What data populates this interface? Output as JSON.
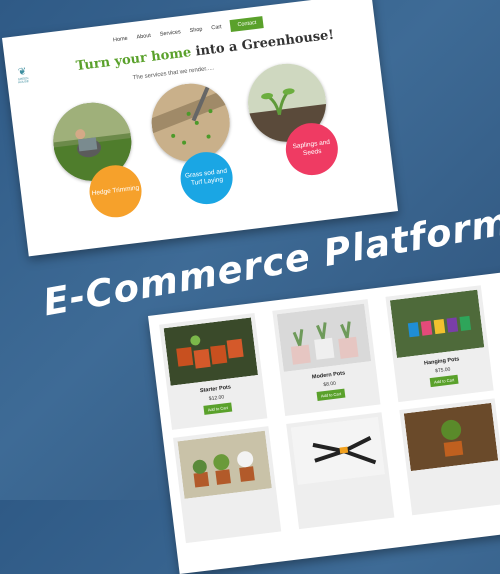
{
  "nav": {
    "items": [
      "Home",
      "About",
      "Services",
      "Shop",
      "Cart"
    ],
    "contact_label": "Contact"
  },
  "logo": {
    "text": "GREEN HOUSE"
  },
  "hero": {
    "headline_green": "Turn your home",
    "headline_rest": " into a Greenhouse!",
    "subtitle": "The services that we render....."
  },
  "services": [
    {
      "label": "Hedge Trimming",
      "color": "#f6a12b"
    },
    {
      "label": "Grass sod and Turf Laying",
      "color": "#1aa6e4"
    },
    {
      "label": "Saplings and Seeds",
      "color": "#ef3b63"
    }
  ],
  "title": "E-Commerce Platform",
  "products": [
    {
      "name": "Starter Pots",
      "price": "$12.00",
      "button": "Add to Cart"
    },
    {
      "name": "Modern Pots",
      "price": "$8.00",
      "button": "Add to Cart"
    },
    {
      "name": "Hanging Pots",
      "price": "$75.00",
      "button": "Add to Cart"
    }
  ],
  "colors": {
    "accent": "#5aa12b",
    "background": "#36618d"
  }
}
